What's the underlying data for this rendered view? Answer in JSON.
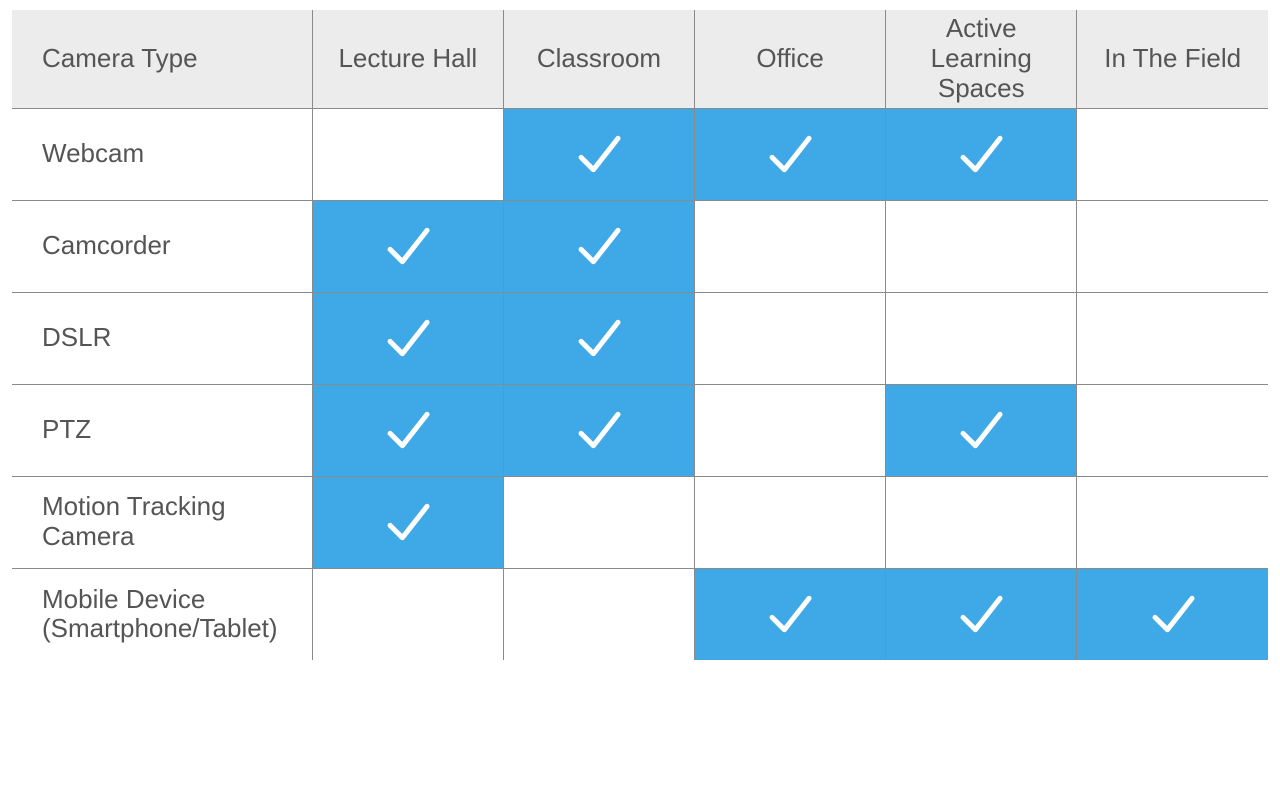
{
  "chart_data": {
    "type": "table",
    "title": "",
    "row_header_label": "Camera Type",
    "columns": [
      "Lecture Hall",
      "Classroom",
      "Office",
      "Active Learning\nSpaces",
      "In The Field"
    ],
    "rows": [
      {
        "label": "Webcam",
        "values": [
          0,
          1,
          1,
          1,
          0
        ]
      },
      {
        "label": "Camcorder",
        "values": [
          1,
          1,
          0,
          0,
          0
        ]
      },
      {
        "label": "DSLR",
        "values": [
          1,
          1,
          0,
          0,
          0
        ]
      },
      {
        "label": "PTZ",
        "values": [
          1,
          1,
          0,
          1,
          0
        ]
      },
      {
        "label": "Motion Tracking\nCamera",
        "values": [
          1,
          0,
          0,
          0,
          0
        ]
      },
      {
        "label": "Mobile Device\n(Smartphone/Tablet)",
        "values": [
          0,
          0,
          1,
          1,
          1
        ]
      }
    ]
  },
  "colors": {
    "check_bg": "#3fa9e8",
    "header_bg": "#ececec",
    "text": "#555"
  }
}
